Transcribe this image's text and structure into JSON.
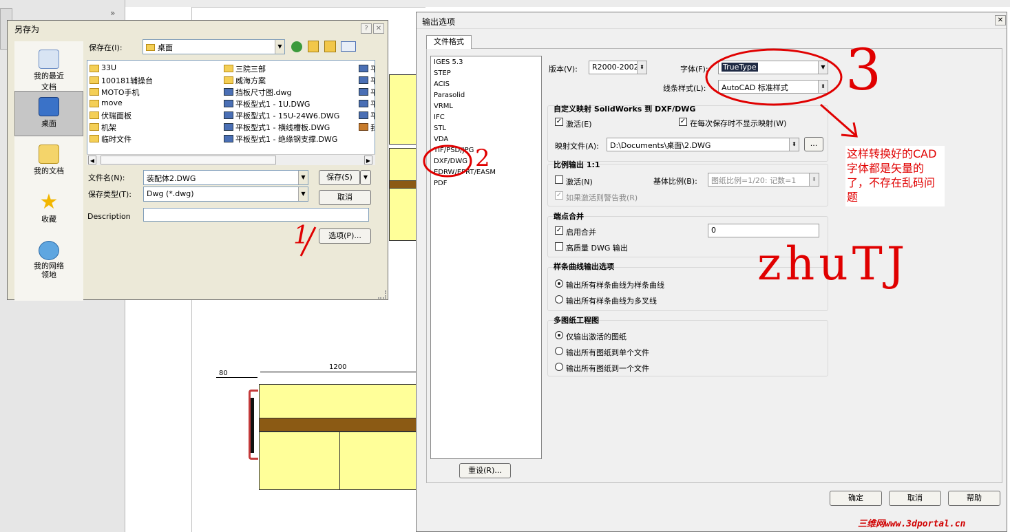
{
  "colors": {
    "annotation_red": "#e00000",
    "part_yellow": "#ffff99",
    "part_brown": "#8b5a14",
    "selection": "#1f2a44"
  },
  "saveas": {
    "title": "另存为",
    "help_btn": "?",
    "close_btn": "✕",
    "save_in_label": "保存在(I):",
    "save_in_value": "桌面",
    "places": [
      {
        "label": "我的最近\n文档",
        "icon": "recent-docs-icon"
      },
      {
        "label": "桌面",
        "icon": "desktop-icon"
      },
      {
        "label": "我的文档",
        "icon": "my-documents-icon"
      },
      {
        "label": "收藏",
        "icon": "favorites-star-icon"
      },
      {
        "label": "我的网络\n领地",
        "icon": "network-places-icon"
      }
    ],
    "files_col1": [
      "33U",
      "100181辅操台",
      "MOTO手机",
      "move",
      "伏瑞面板",
      "机架",
      "临时文件"
    ],
    "files_col2": [
      "三院三部",
      "威海方案",
      "挡板尺寸图.dwg",
      "平板型式1 - 1U.DWG",
      "平板型式1 - 15U-24W6.DWG",
      "平板型式1 - 横线槽板.DWG",
      "平板型式1 - 绝缘钢支撑.DWG"
    ],
    "files_col3": [
      "平",
      "平",
      "平",
      "平",
      "平",
      "我"
    ],
    "filename_label": "文件名(N):",
    "filename_value": "装配体2.DWG",
    "filetype_label": "保存类型(T):",
    "filetype_value": "Dwg (*.dwg)",
    "description_label": "Description",
    "save_btn": "保存(S)",
    "cancel_btn": "取消",
    "options_btn": "选项(P)..."
  },
  "outopt": {
    "title": "输出选项",
    "close_btn": "✕",
    "tab": "文件格式",
    "formats": [
      "IGES 5.3",
      "STEP",
      "ACIS",
      "Parasolid",
      "VRML",
      "IFC",
      "STL",
      "VDA",
      "TIF/PSD/JPG",
      "DXF/DWG",
      "EDRW/EPRT/EASM",
      "PDF"
    ],
    "selected_format": "DXF/DWG",
    "version_label": "版本(V):",
    "version_value": "R2000-2002",
    "font_label": "字体(F):",
    "font_value": "TrueType",
    "linestyle_label": "线条样式(L):",
    "linestyle_value": "AutoCAD 标准样式",
    "map_group_title": "自定义映射 SolidWorks 到 DXF/DWG",
    "map_activate": "激活(E)",
    "map_noshow": "在每次保存时不显示映射(W)",
    "map_file_label": "映射文件(A):",
    "map_file_value": "D:\\Documents\\桌面\\2.DWG",
    "browse_btn": "...",
    "scale_group_title": "比例输出 1:1",
    "scale_activate": "激活(N)",
    "base_scale_label": "基体比例(B):",
    "base_scale_value": "图纸比例=1/20: 记数=1",
    "scale_warn": "如果激活则警告我(R)",
    "endpoint_group_title": "端点合并",
    "endpoint_enable": "启用合并",
    "endpoint_value": "0",
    "hq_dwg": "高质量 DWG 输出",
    "spline_group_title": "样条曲线输出选项",
    "spline_opt1": "输出所有样条曲线为样条曲线",
    "spline_opt2": "输出所有样条曲线为多叉线",
    "multi_group_title": "多图纸工程图",
    "multi_opt1": "仅输出激活的图纸",
    "multi_opt2": "输出所有图纸到单个文件",
    "multi_opt3": "输出所有图纸到一个文件",
    "reset_btn": "重设(R)...",
    "ok_btn": "确定",
    "cancel_btn": "取消",
    "help_btn": "帮助"
  },
  "cad": {
    "dim_1200": "1200",
    "dim_80": "80"
  },
  "annotations": {
    "mark1": "1",
    "mark2": "2",
    "mark3": "3",
    "note": "这样转换好的CAD字体都是矢量的了，不存在乱码问题",
    "signature": "zhuTJ",
    "watermark": "三维网www.3dportal.cn"
  }
}
